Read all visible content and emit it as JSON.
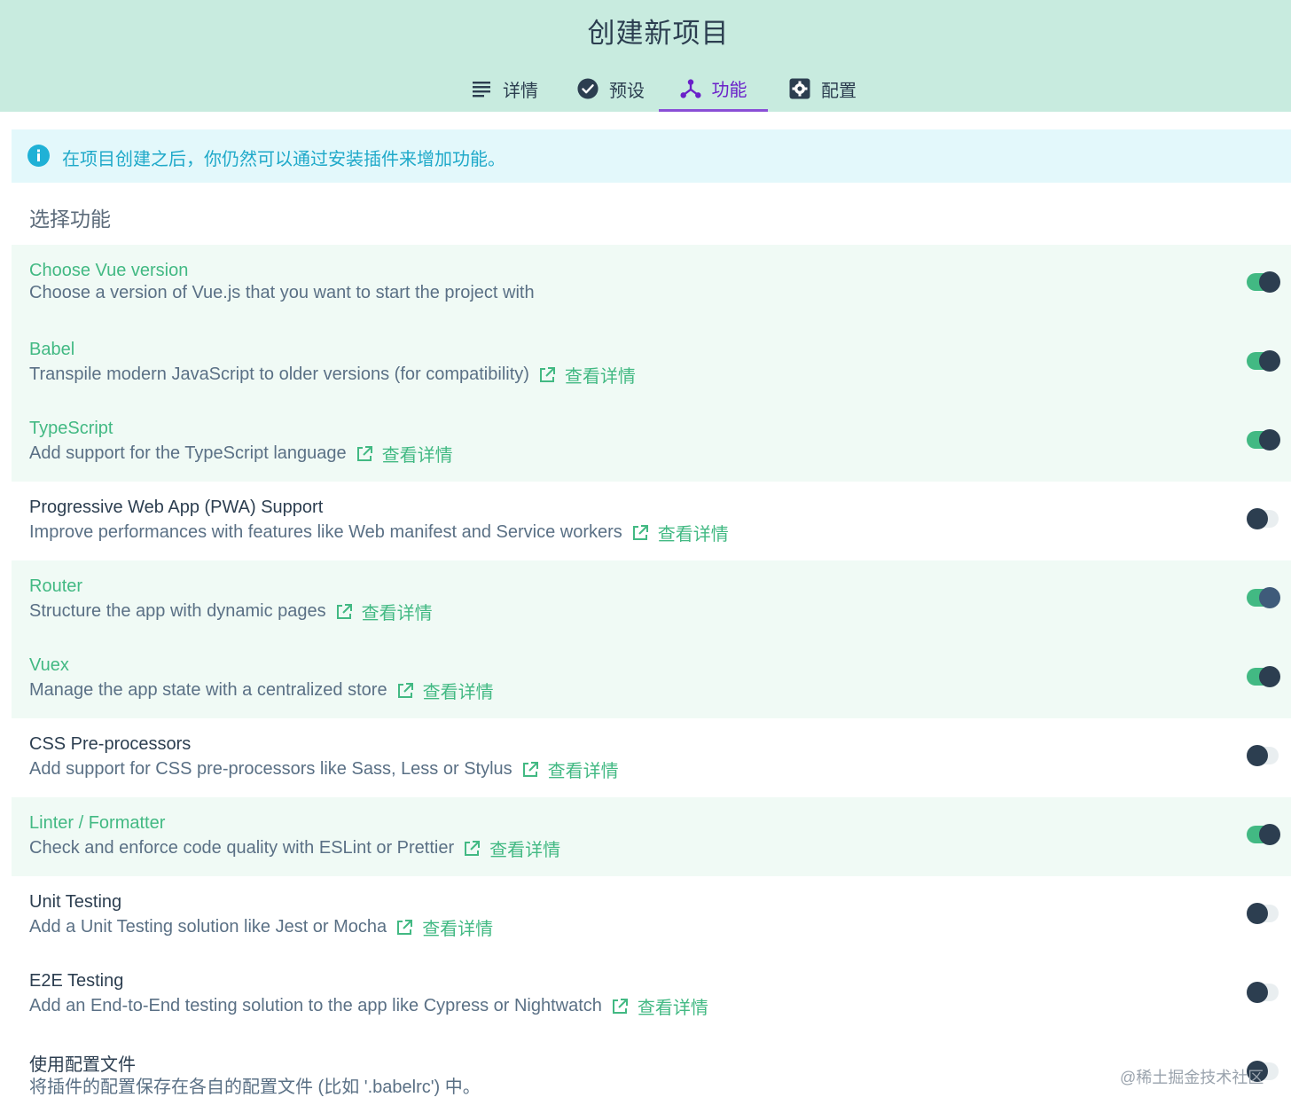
{
  "header": {
    "title": "创建新项目",
    "tabs": [
      {
        "label": "详情",
        "icon": "list-icon",
        "active": false
      },
      {
        "label": "预设",
        "icon": "check-circle-icon",
        "active": false
      },
      {
        "label": "功能",
        "icon": "fork-icon",
        "active": true
      },
      {
        "label": "配置",
        "icon": "gear-box-icon",
        "active": false
      }
    ]
  },
  "info": {
    "icon": "info-icon",
    "text": "在项目创建之后，你仍然可以通过安装插件来增加功能。"
  },
  "section_title": "选择功能",
  "more_label": "查看详情",
  "features": [
    {
      "name": "Choose Vue version",
      "desc": "Choose a version of Vue.js that you want to start the project with",
      "enabled": true,
      "has_link": false
    },
    {
      "name": "Babel",
      "desc": "Transpile modern JavaScript to older versions (for compatibility)",
      "enabled": true,
      "has_link": true
    },
    {
      "name": "TypeScript",
      "desc": "Add support for the TypeScript language",
      "enabled": true,
      "has_link": true
    },
    {
      "name": "Progressive Web App (PWA) Support",
      "desc": "Improve performances with features like Web manifest and Service workers",
      "enabled": false,
      "has_link": true
    },
    {
      "name": "Router",
      "desc": "Structure the app with dynamic pages",
      "enabled": true,
      "has_link": true
    },
    {
      "name": "Vuex",
      "desc": "Manage the app state with a centralized store",
      "enabled": true,
      "has_link": true
    },
    {
      "name": "CSS Pre-processors",
      "desc": "Add support for CSS pre-processors like Sass, Less or Stylus",
      "enabled": false,
      "has_link": true
    },
    {
      "name": "Linter / Formatter",
      "desc": "Check and enforce code quality with ESLint or Prettier",
      "enabled": true,
      "has_link": true
    },
    {
      "name": "Unit Testing",
      "desc": "Add a Unit Testing solution like Jest or Mocha",
      "enabled": false,
      "has_link": true
    },
    {
      "name": "E2E Testing",
      "desc": "Add an End-to-End testing solution to the app like Cypress or Nightwatch",
      "enabled": false,
      "has_link": true
    },
    {
      "name": "使用配置文件",
      "desc": "将插件的配置保存在各自的配置文件 (比如 '.babelrc') 中。",
      "enabled": false,
      "has_link": false
    }
  ],
  "watermark": "@稀土掘金技术社区",
  "colors": {
    "header_bg": "#c8ebdf",
    "accent_green": "#42b983",
    "active_tab": "#6a1fc9",
    "info_text": "#1fa9c9",
    "dark": "#2c3e50"
  }
}
